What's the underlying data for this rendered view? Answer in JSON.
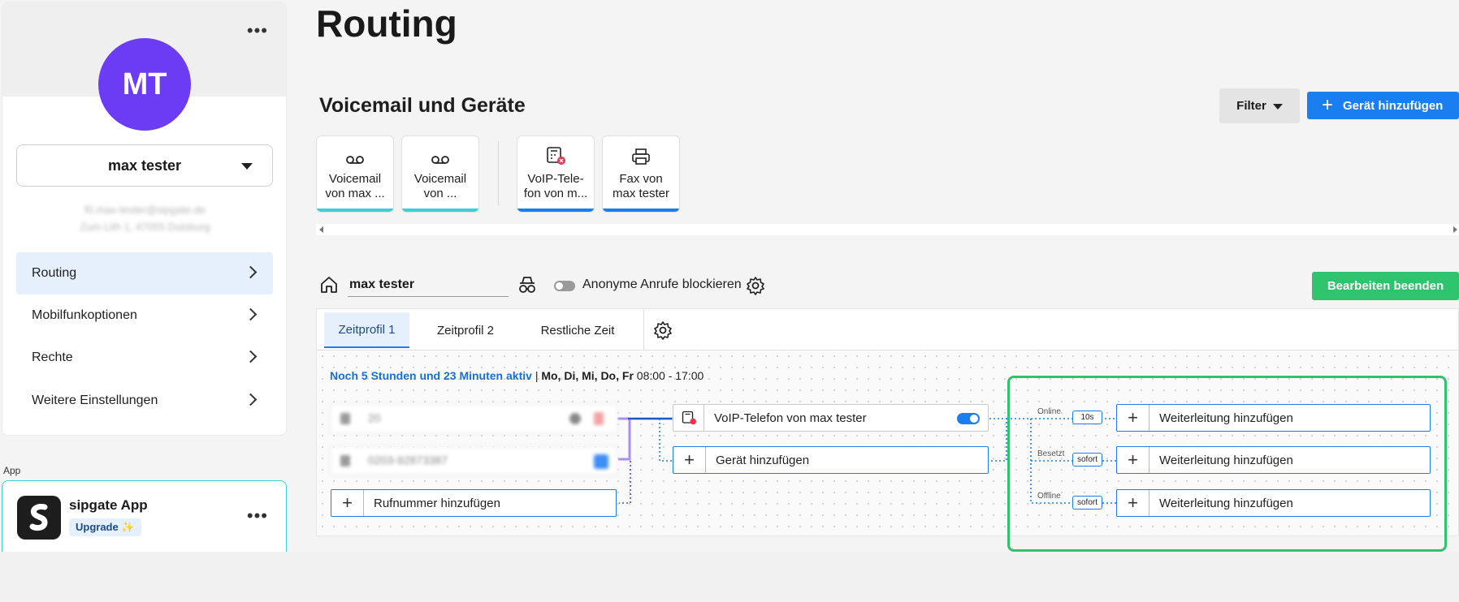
{
  "sidebar": {
    "avatar_initials": "MT",
    "user_name": "max tester",
    "blurred_line1": "f0.max-tester@sipgate.de",
    "blurred_line2": "Zum Lith 1, 47055 Duisburg",
    "nav": [
      {
        "label": "Routing",
        "active": true
      },
      {
        "label": "Mobilfunkoptionen",
        "active": false
      },
      {
        "label": "Rechte",
        "active": false
      },
      {
        "label": "Weitere Einstellungen",
        "active": false
      }
    ],
    "app_section_label": "App",
    "app_name": "sipgate App",
    "app_badge": "Upgrade ✨"
  },
  "page": {
    "title": "Routing",
    "section_title": "Voicemail und Geräte",
    "filter_label": "Filter",
    "add_device_label": "Gerät hinzufügen"
  },
  "devices": [
    {
      "label": "Voicemail von max ...",
      "icon": "voicemail-icon",
      "bar_color": "#3ecfd6"
    },
    {
      "label": "Voicemail von ...",
      "icon": "voicemail-icon",
      "bar_color": "#3ecfd6"
    },
    {
      "label": "VoIP-Tele-fon von m...",
      "icon": "voip-phone-icon",
      "bar_color": "#1a7ef0"
    },
    {
      "label": "Fax von max tester",
      "icon": "printer-icon",
      "bar_color": "#1a7ef0"
    }
  ],
  "routing": {
    "profile_name": "max tester",
    "anon_label": "Anonyme Anrufe blockieren",
    "finish_label": "Bearbeiten beenden",
    "tabs": [
      "Zeitprofil 1",
      "Zeitprofil 2",
      "Restliche Zeit"
    ],
    "active_text": "Noch 5 Stunden und 23 Minuten aktiv",
    "days": "Mo, Di, Mi, Do, Fr",
    "hours": "08:00 - 17:00",
    "numbers": [
      "20",
      "0203-92873387"
    ],
    "add_number_label": "Rufnummer hinzufügen",
    "voip_device_label": "VoIP-Telefon von max tester",
    "add_device_label": "Gerät hinzufügen",
    "forwards": [
      {
        "condition": "Online",
        "delay": "10s",
        "label": "Weiterleitung hinzufügen"
      },
      {
        "condition": "Besetzt",
        "delay": "sofort",
        "label": "Weiterleitung hinzufügen"
      },
      {
        "condition": "Offline",
        "delay": "sofort",
        "label": "Weiterleitung hinzufügen"
      }
    ]
  },
  "colors": {
    "accent": "#1a7ef0",
    "avatar": "#6c3cf5",
    "success": "#2ec46e",
    "voicemail": "#3ecfd6"
  }
}
